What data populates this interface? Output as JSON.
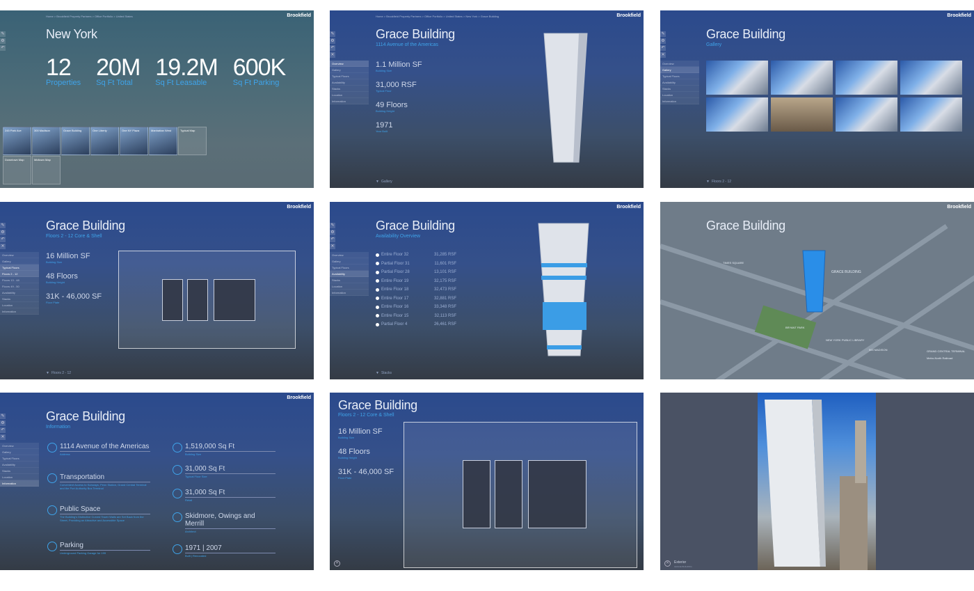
{
  "brand": "Brookfield",
  "p1": {
    "crumb": "Home > Brookfield Property Partners > Office Portfolio > United States",
    "title": "New York",
    "stats": [
      {
        "num": "12",
        "lbl": "Properties"
      },
      {
        "num": "20M",
        "lbl": "Sq Ft Total"
      },
      {
        "num": "19.2M",
        "lbl": "Sq Ft Leasable"
      },
      {
        "num": "600K",
        "lbl": "Sq Ft Parking"
      }
    ],
    "tiles": [
      "245 Park Ave",
      "300 Madison",
      "Grace Building",
      "One Liberty",
      "One NY Plaza",
      "Manhattan West",
      "Typical Map",
      "Downtown Map",
      "Midtown Map"
    ]
  },
  "p2": {
    "crumb": "Home > Brookfield Property Partners > Office Portfolio > United States > New York > Grace Building",
    "title": "Grace Building",
    "sub": "1114 Avenue of the Americas",
    "facts": [
      {
        "v": "1.1 Million SF",
        "l": "Building Size"
      },
      {
        "v": "31,000 RSF",
        "l": "Typical Floor"
      },
      {
        "v": "49 Floors",
        "l": "Building Height"
      },
      {
        "v": "1971",
        "l": "Year Built"
      }
    ],
    "menu": [
      "Overview",
      "Gallery",
      "Typical Floors",
      "Availability",
      "Stacks",
      "Location",
      "Information"
    ],
    "bottom": "Gallery"
  },
  "p3": {
    "title": "Grace Building",
    "sub": "Gallery",
    "bottom": "Floors 2 - 12"
  },
  "p4": {
    "title": "Grace Building",
    "sub": "Floors 2 - 12 Core & Shell",
    "facts": [
      {
        "v": "16 Million SF",
        "l": "Building Size"
      },
      {
        "v": "48 Floors",
        "l": "Building Height"
      },
      {
        "v": "31K - 46,000 SF",
        "l": "Floor Plate"
      }
    ],
    "menu": [
      "Overview",
      "Gallery",
      "Typical Floors",
      "Floors 2 - 12",
      "Floors 13 - 48",
      "Floors 49 - 50",
      "Availability",
      "Stacks",
      "Location",
      "Information"
    ],
    "bottom": "Floors 2 - 12"
  },
  "p5": {
    "title": "Grace Building",
    "sub": "Availability Overview",
    "rows": [
      {
        "f": "Entire Floor 32",
        "s": "31,285 RSF"
      },
      {
        "f": "Partial Floor 31",
        "s": "11,601 RSF"
      },
      {
        "f": "Partial Floor 28",
        "s": "13,101 RSF"
      },
      {
        "f": "Entire Floor 19",
        "s": "32,175 RSF"
      },
      {
        "f": "Entire Floor 18",
        "s": "32,473 RSF"
      },
      {
        "f": "Entire Floor 17",
        "s": "32,881 RSF"
      },
      {
        "f": "Entire Floor 16",
        "s": "33,348 RSF"
      },
      {
        "f": "Entire Floor 15",
        "s": "32,113 RSF"
      },
      {
        "f": "Partial Floor 4",
        "s": "26,461 RSF"
      }
    ],
    "bottom": "Stacks"
  },
  "p6": {
    "title": "Grace Building",
    "label": "GRACE BUILDING",
    "places": [
      "BRYANT PARK",
      "NEW YORK PUBLIC LIBRARY",
      "GRAND CENTRAL TERMINAL",
      "Metro-North Railroad",
      "TIMES SQUARE",
      "500 MADISON"
    ]
  },
  "p7": {
    "title": "Grace Building",
    "sub": "Information",
    "items": [
      {
        "t": "1114 Avenue of the Americas",
        "d": "Address"
      },
      {
        "t": "Transportation",
        "d": "Convenient Access to Subways, Penn Station, Grand Central Terminal and the Port Authority Bus Terminal"
      },
      {
        "t": "Public Space",
        "d": "The Building's Distinctive Curved Tower Walls are Set Back from the Street, Providing an Attractive and Accessible Space"
      },
      {
        "t": "Parking",
        "d": "Underground Parking Garage for 199"
      },
      {
        "t": "1,519,000 Sq Ft",
        "d": "Building Size"
      },
      {
        "t": "31,000 Sq Ft",
        "d": "Typical Floor Size"
      },
      {
        "t": "31,000 Sq Ft",
        "d": "Retail"
      },
      {
        "t": "Skidmore, Owings and Merrill",
        "d": "Architect"
      },
      {
        "t": "1971 | 2007",
        "d": "Built | Renovated"
      }
    ]
  },
  "p8": {
    "title": "Grace Building",
    "sub": "Floors 2 - 12 Core & Shell",
    "facts": [
      {
        "v": "16 Million SF",
        "l": "Building Size"
      },
      {
        "v": "48 Floors",
        "l": "Building Height"
      },
      {
        "v": "31K - 46,000 SF",
        "l": "Floor Plate"
      }
    ]
  },
  "p9": {
    "cap": "Exterior",
    "cap2": "GRACE BUILDING"
  }
}
